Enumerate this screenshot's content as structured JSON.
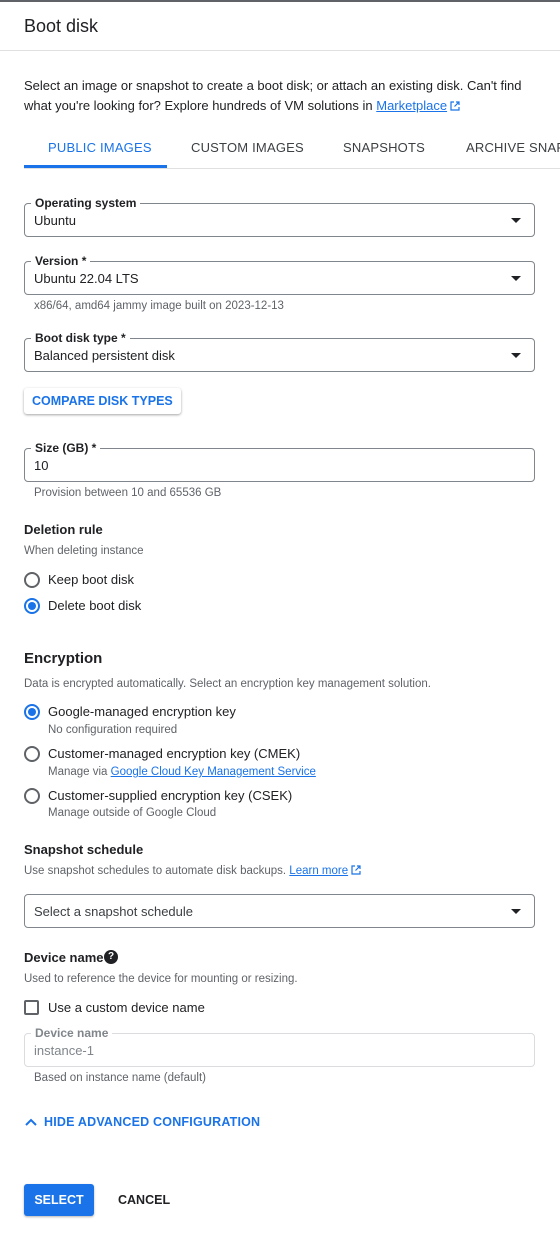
{
  "header": {
    "title": "Boot disk"
  },
  "intro": {
    "text": "Select an image or snapshot to create a boot disk; or attach an existing disk. Can't find what you're looking for? Explore hundreds of VM solutions in ",
    "link": "Marketplace"
  },
  "tabs": [
    {
      "label": "PUBLIC IMAGES",
      "active": true
    },
    {
      "label": "CUSTOM IMAGES",
      "active": false
    },
    {
      "label": "SNAPSHOTS",
      "active": false
    },
    {
      "label": "ARCHIVE SNAPSHOTS",
      "active": false
    }
  ],
  "os": {
    "label": "Operating system",
    "value": "Ubuntu"
  },
  "version": {
    "label": "Version *",
    "value": "Ubuntu 22.04 LTS",
    "hint": "x86/64, amd64 jammy image built on 2023-12-13"
  },
  "disk_type": {
    "label": "Boot disk type *",
    "value": "Balanced persistent disk"
  },
  "compare_button": "COMPARE DISK TYPES",
  "size": {
    "label": "Size (GB) *",
    "value": "10",
    "hint": "Provision between 10 and 65536 GB"
  },
  "deletion": {
    "title": "Deletion rule",
    "subtitle": "When deleting instance",
    "options": [
      {
        "label": "Keep boot disk",
        "selected": false
      },
      {
        "label": "Delete boot disk",
        "selected": true
      }
    ]
  },
  "encryption": {
    "title": "Encryption",
    "subtitle": "Data is encrypted automatically. Select an encryption key management solution.",
    "options": [
      {
        "label": "Google-managed encryption key",
        "desc": "No configuration required",
        "selected": true
      },
      {
        "label": "Customer-managed encryption key (CMEK)",
        "desc_prefix": "Manage via ",
        "desc_link": "Google Cloud Key Management Service",
        "selected": false
      },
      {
        "label": "Customer-supplied encryption key (CSEK)",
        "desc": "Manage outside of Google Cloud",
        "selected": false
      }
    ]
  },
  "snapshot": {
    "title": "Snapshot schedule",
    "subtitle": "Use snapshot schedules to automate disk backups. ",
    "link": "Learn more",
    "placeholder": "Select a snapshot schedule"
  },
  "device": {
    "title": "Device name",
    "help_glyph": "?",
    "subtitle": "Used to reference the device for mounting or resizing.",
    "checkbox_label": "Use a custom device name",
    "checkbox_checked": false,
    "field_label": "Device name",
    "field_value": "instance-1",
    "hint": "Based on instance name (default)"
  },
  "advanced_toggle": "HIDE ADVANCED CONFIGURATION",
  "actions": {
    "select": "SELECT",
    "cancel": "CANCEL"
  },
  "colors": {
    "accent": "#1a73e8",
    "text": "#202124",
    "muted": "#5f6368"
  }
}
